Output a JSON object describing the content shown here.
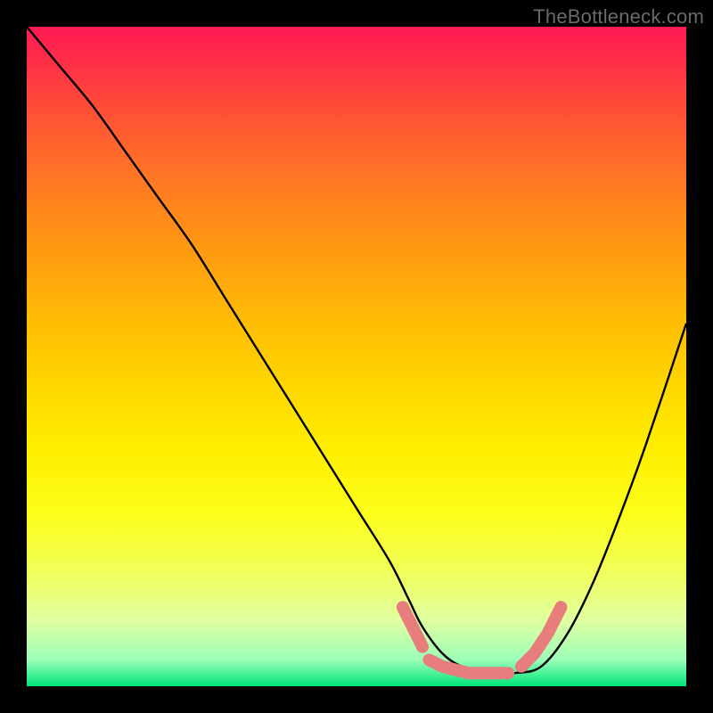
{
  "watermark": "TheBottleneck.com",
  "colors": {
    "curve_stroke": "#000000",
    "marker_stroke": "#e77d7d",
    "marker_fill": "none"
  },
  "chart_data": {
    "type": "line",
    "title": "",
    "xlabel": "",
    "ylabel": "",
    "xlim": [
      0,
      100
    ],
    "ylim": [
      0,
      100
    ],
    "series": [
      {
        "name": "curve",
        "x": [
          0,
          5,
          10,
          15,
          20,
          25,
          30,
          35,
          40,
          45,
          50,
          55,
          58,
          60,
          63,
          66,
          70,
          74,
          78,
          82,
          86,
          90,
          94,
          100
        ],
        "y": [
          100,
          94,
          88,
          81,
          74,
          67,
          59,
          51,
          43,
          35,
          27,
          19,
          13,
          9,
          5,
          3,
          2,
          2,
          3,
          8,
          16,
          26,
          37,
          55
        ]
      }
    ],
    "markers": [
      {
        "name": "highlight-left",
        "x": [
          57,
          58,
          59,
          60
        ],
        "y": [
          12,
          10,
          8,
          6
        ]
      },
      {
        "name": "highlight-flat",
        "x": [
          61,
          63,
          65,
          67,
          69,
          71,
          73
        ],
        "y": [
          4,
          3,
          2.5,
          2,
          2,
          2,
          2
        ]
      },
      {
        "name": "highlight-right",
        "x": [
          75,
          77,
          79,
          81
        ],
        "y": [
          3,
          5,
          8,
          12
        ]
      }
    ]
  }
}
